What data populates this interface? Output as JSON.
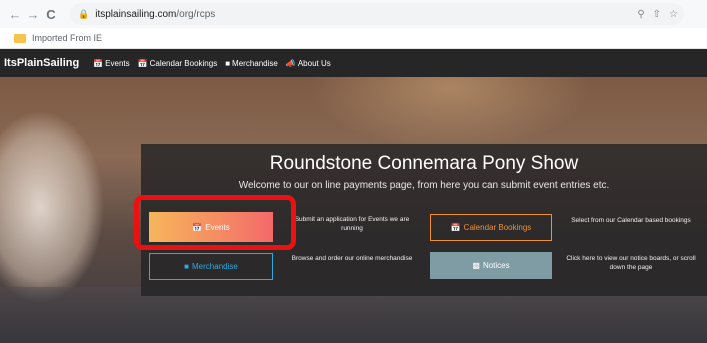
{
  "browser": {
    "back_glyph": "←",
    "forward_glyph": "→",
    "reload_glyph": "C",
    "url_host": "itsplainsailing.com",
    "url_path": "/org/rcps",
    "bookmark_folder": "Imported From IE"
  },
  "sitenav": {
    "brand": "ItsPlainSailing",
    "items": [
      {
        "label": "Events"
      },
      {
        "label": "Calendar Bookings"
      },
      {
        "label": "Merchandise"
      },
      {
        "label": "About Us"
      }
    ]
  },
  "panel": {
    "title": "Roundstone Connemara Pony Show",
    "subtitle": "Welcome to our on line payments page, from here you can submit event entries etc.",
    "buttons": {
      "events": "Events",
      "calendar": "Calendar Bookings",
      "merchandise": "Merchandise",
      "notices": "Notices"
    },
    "descriptions": {
      "events": "Submit an application for Events we are running",
      "calendar": "Select from our Calendar based bookings",
      "merchandise": "Browse and order our online merchandise",
      "notices": "Click here to view our notice boards, or scroll down the page"
    }
  },
  "colors": {
    "events_gradient_start": "#f6b65a",
    "events_gradient_end": "#f46a6a",
    "calendar_accent": "#f3902e",
    "merch_accent": "#2fa9e1",
    "notices_bg": "#7f9ba4",
    "highlight": "#ec1111"
  }
}
